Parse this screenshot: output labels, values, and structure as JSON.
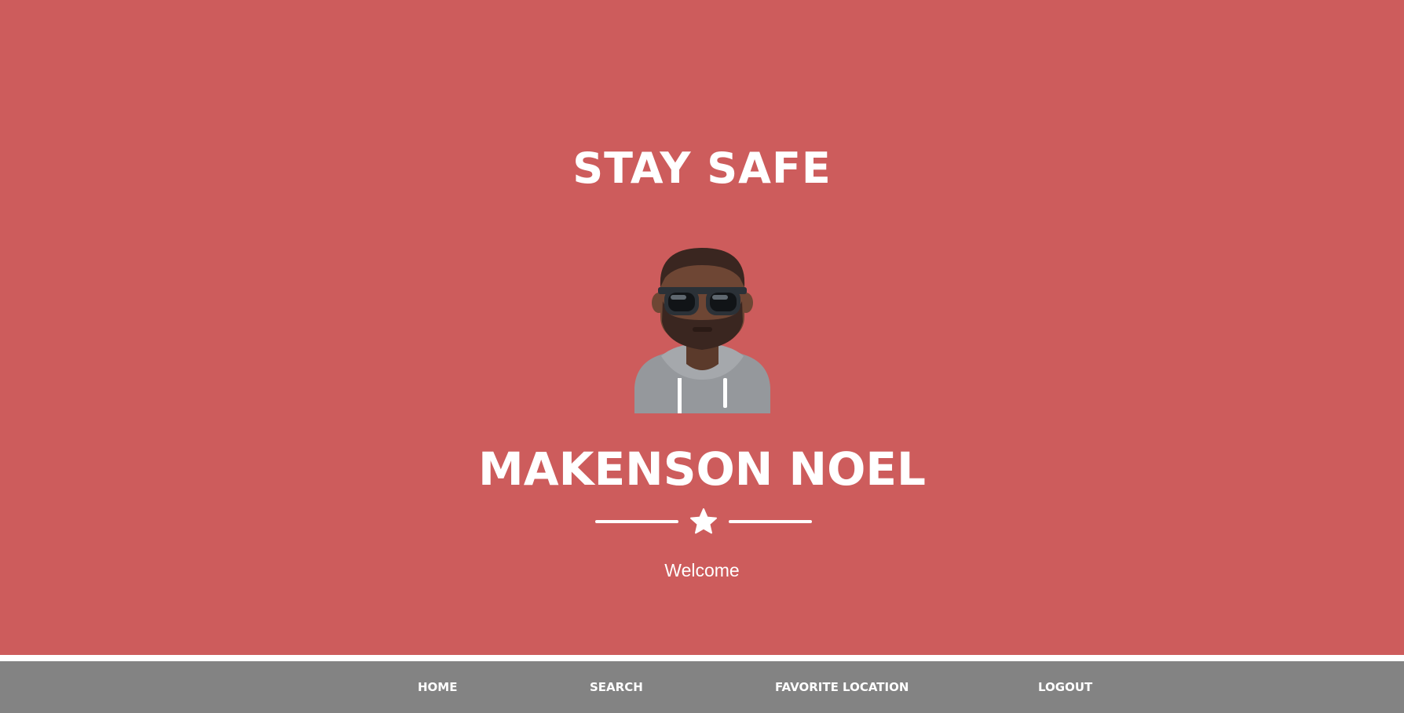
{
  "hero": {
    "title": "STAY SAFE",
    "user_name": "MAKENSON NOEL",
    "welcome_text": "Welcome",
    "background_color": "#cd5c5c",
    "avatar_icon": "avatar-man-sunglasses-hoodie",
    "divider_icon": "star-icon"
  },
  "nav": {
    "background_color": "#838383",
    "items": [
      {
        "label": "HOME"
      },
      {
        "label": "SEARCH"
      },
      {
        "label": "FAVORITE LOCATION"
      },
      {
        "label": "LOGOUT"
      }
    ]
  }
}
